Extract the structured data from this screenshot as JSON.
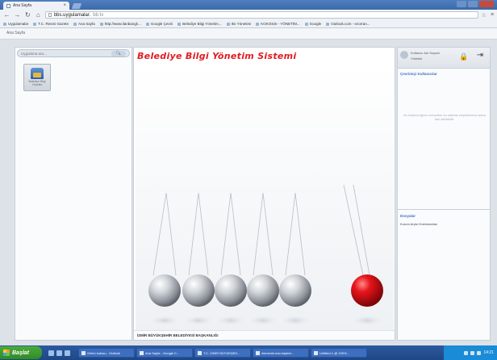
{
  "browser": {
    "tab_title": "Ana Sayfa",
    "url_domain": "bbs.uygulamalar.",
    "url_path": "bb.tv",
    "bookmarks": [
      "Uygulamalar",
      "T.C. Resmi Gazete",
      "Ana Sayfa",
      "http://www.ilanbanglı...",
      "Google Çeviri",
      "Belediye Bilgi Yönetim...",
      "Ikn Yönetimi",
      "KOKOSSI - YÖNETİM...",
      "Google",
      "Outlook.com - ezorran..."
    ]
  },
  "page": {
    "breadcrumb": "Ana Sayfa"
  },
  "left_panel": {
    "search_placeholder": "Uygulama ara...",
    "search_button": "🔍",
    "app_tile_label": "Belediye Bilgi Yönetim"
  },
  "main": {
    "title": "Belediye Bilgi Yönetim Sistemi",
    "footer": "İZMİR BÜYÜKŞEHİR BELEDİYESİ BAŞKANLIĞI"
  },
  "right_panel": {
    "user_name": "Kullanıcı Adı Soyadı",
    "user_role": "Yönetici",
    "online_users_title": "Çevrimiçi Kullanıcılar",
    "notice": "Bu kullanıcılığınız mevcutları bu sisteme erişebilmeniz adına fark ettirilebilir.",
    "documents_title": "Dosyalar",
    "documents_item": "Kurum Arşivi Dokümanları"
  },
  "taskbar": {
    "start_label": "Başlat",
    "tasks": [
      "Gelen kutusu - Outlook",
      "Ana Sayfa - Google C...",
      "T.C. İZMİR BÜYÜKŞEH...",
      "elements kan kaybet...",
      "Untitled-1 @ 100%..."
    ],
    "clock": "14:21"
  },
  "colors": {
    "brand_red": "#e11b22",
    "link_blue": "#3c74c0",
    "taskbar_blue": "#1e4786",
    "start_green": "#2f8a26"
  },
  "icons": {
    "search": "search-icon",
    "lock": "lock-icon",
    "exit": "exit-icon",
    "app_tile": "building-icon"
  }
}
